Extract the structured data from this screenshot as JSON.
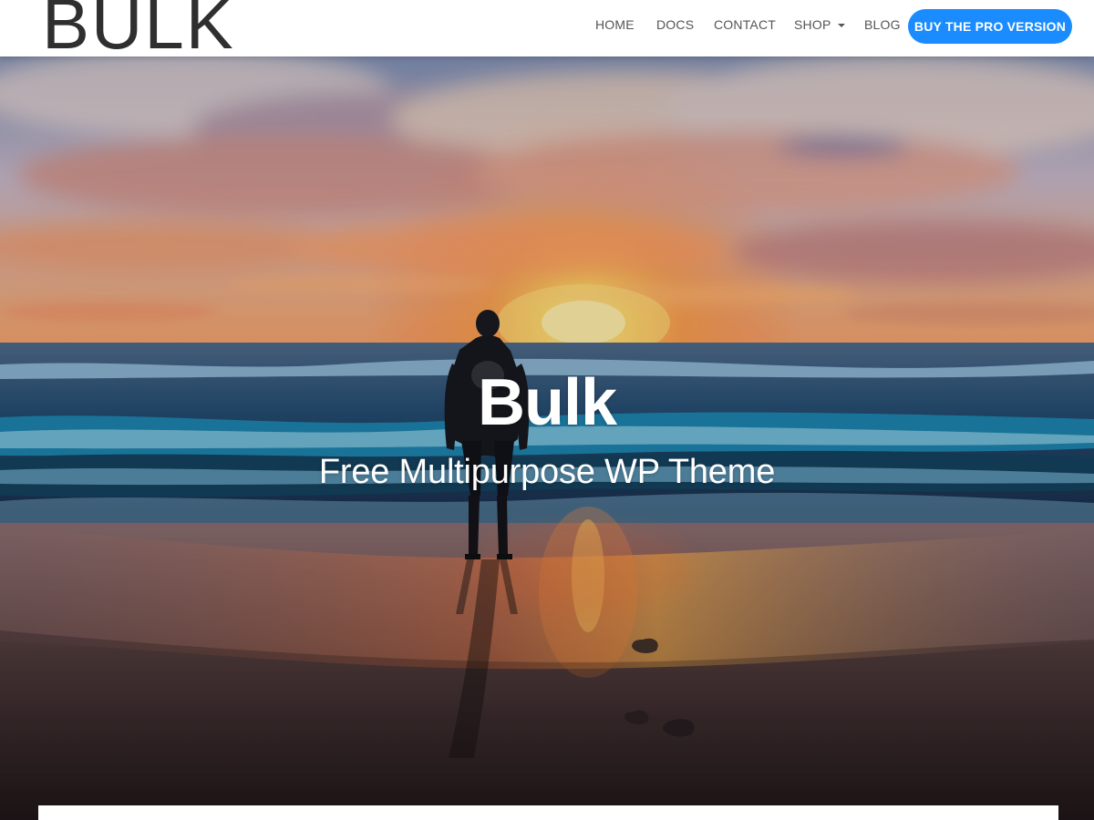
{
  "header": {
    "logo": "BULK",
    "nav": [
      "HOME",
      "DOCS",
      "CONTACT",
      "SHOP",
      "BLOG"
    ],
    "cta_label": "BUY THE PRO VERSION"
  },
  "hero": {
    "title": "Bulk",
    "subtitle": "Free Multipurpose WP Theme"
  },
  "colors": {
    "accent": "#1a8cff",
    "nav_text": "#555555",
    "header_bg": "#ffffff"
  },
  "icons": {
    "shop_dropdown": "caret-down-icon"
  }
}
